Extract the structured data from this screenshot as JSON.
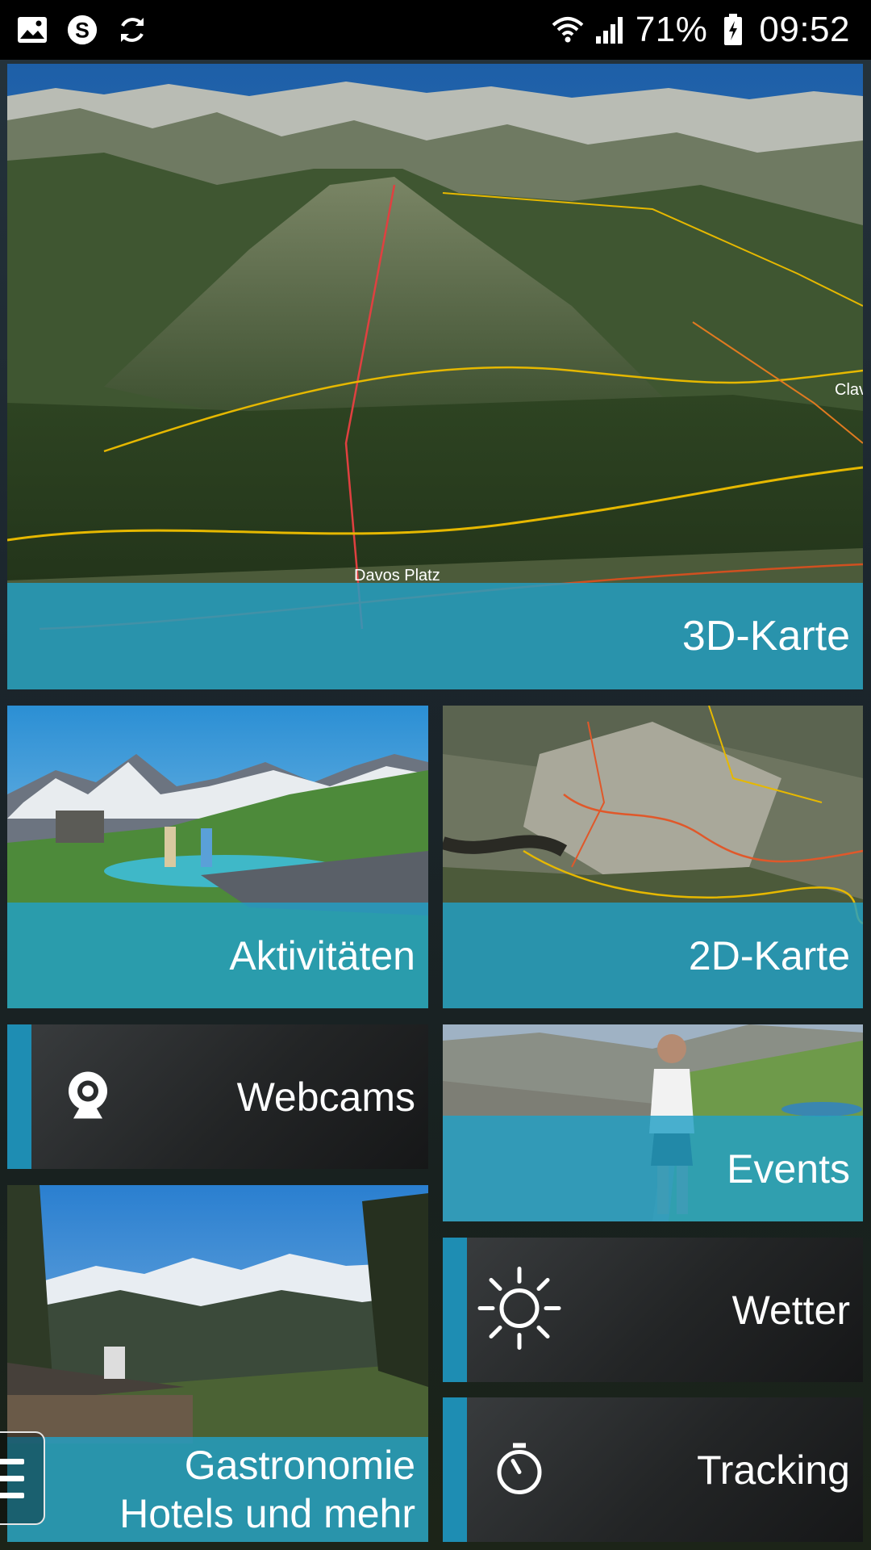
{
  "status_bar": {
    "icons_left": [
      "image-icon",
      "skype-icon",
      "sync-icon"
    ],
    "icons_right": [
      "wifi-icon",
      "signal-icon",
      "battery-icon"
    ],
    "battery": "71%",
    "time": "09:52"
  },
  "tiles": {
    "map3d": {
      "label": "3D-Karte",
      "place_label": "Davos Platz",
      "edge_label": "Clav"
    },
    "activities": {
      "label": "Aktivitäten"
    },
    "map2d": {
      "label": "2D-Karte"
    },
    "webcams": {
      "label": "Webcams",
      "icon": "webcam-icon"
    },
    "events": {
      "label": "Events"
    },
    "gastro": {
      "label_line1": "Gastronomie",
      "label_line2": "Hotels und mehr"
    },
    "weather": {
      "label": "Wetter",
      "icon": "sun-icon"
    },
    "tracking": {
      "label": "Tracking",
      "icon": "stopwatch-icon"
    }
  },
  "menu": {
    "icon": "hamburger-menu-icon"
  },
  "colors": {
    "accent": "#22a0c6",
    "accent_bar": "#1e8db3",
    "status_bar": "#000000"
  }
}
